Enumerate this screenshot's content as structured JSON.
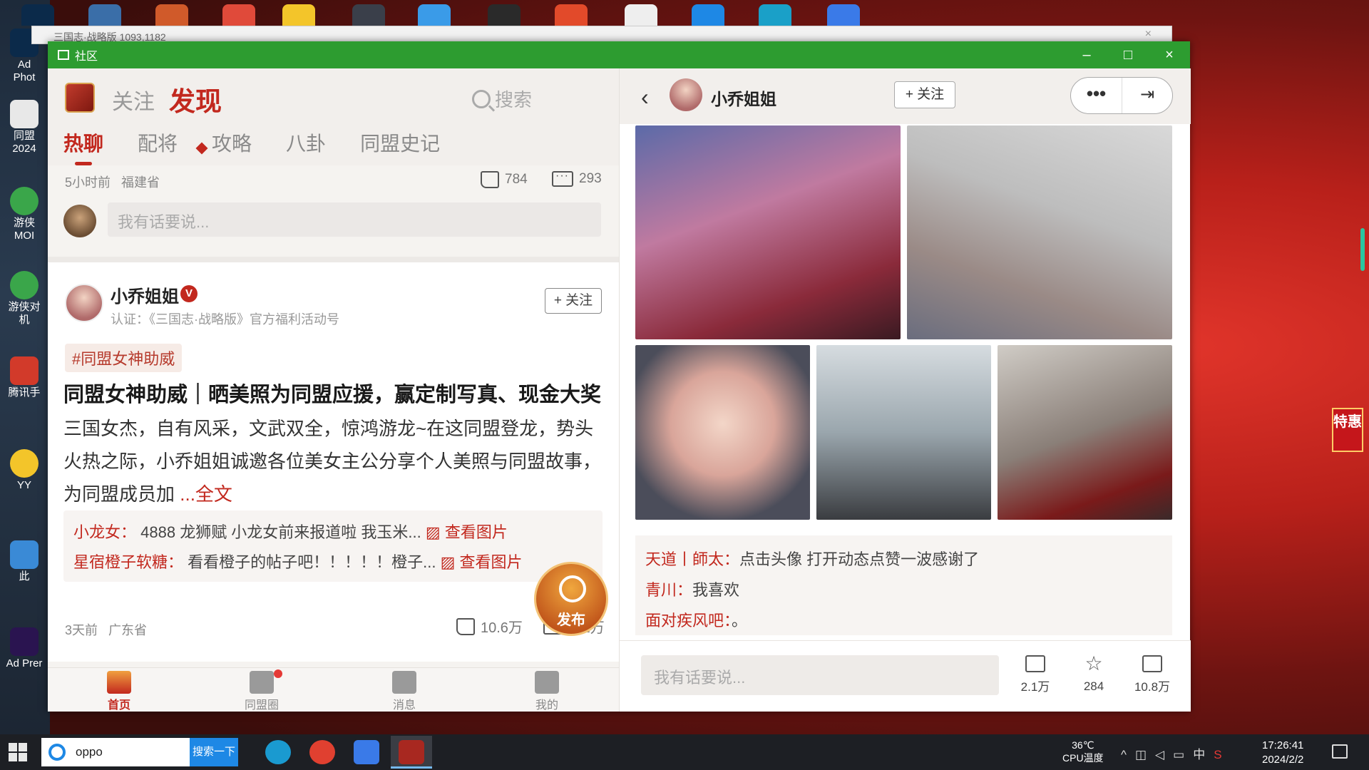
{
  "desktop": {
    "icons": [
      {
        "label": "Ad Phot"
      },
      {
        "label": "同盟 2024"
      },
      {
        "label": "游侠 MOI"
      },
      {
        "label": "游侠对 机"
      },
      {
        "label": "腾讯手"
      },
      {
        "label": "YY"
      },
      {
        "label": "此"
      },
      {
        "label": "Ad Prer"
      }
    ],
    "background_window_title": "三国志·战略版 1093,1182",
    "promo_badge": "特惠"
  },
  "window": {
    "title": "社区",
    "minimize": "–",
    "maximize": "□",
    "close": "×"
  },
  "left": {
    "nav": {
      "follow": "关注",
      "discover": "发现"
    },
    "search_placeholder": "搜索",
    "subtabs": [
      "热聊",
      "配将",
      "攻略",
      "八卦",
      "同盟史记"
    ],
    "post1": {
      "time": "5小时前",
      "location": "福建省",
      "likes": "784",
      "comments": "293",
      "comment_placeholder": "我有话要说..."
    },
    "post2": {
      "author": "小乔姐姐",
      "verified": "V",
      "certification": "认证：《三国志·战略版》官方福利活动号",
      "follow": "+ 关注",
      "tag": "#同盟女神助威",
      "title": "同盟女神助威｜晒美照为同盟应援，赢定制写真、现金大奖",
      "body": "三国女杰，自有风采，文武双全，惊鸿游龙~在这同盟登龙，势头火热之际，小乔姐姐诚邀各位美女主公分享个人美照与同盟故事，为同盟成员加",
      "more": "...全文",
      "comments": [
        {
          "user": "小龙女：",
          "text": "4888 龙狮赋 小龙女前来报道啦 我玉米...",
          "link": "查看图片"
        },
        {
          "user": "星宿橙子软糖：",
          "text": "看看橙子的帖子吧！！！！！橙子...",
          "link": "查看图片"
        }
      ],
      "time": "3天前",
      "location": "广东省",
      "likes": "10.6万",
      "comment_count": "2.1万"
    },
    "publish": "发布",
    "bottom_nav": [
      {
        "label": "首页"
      },
      {
        "label": "同盟圈"
      },
      {
        "label": "消息"
      },
      {
        "label": "我的"
      }
    ]
  },
  "right": {
    "author": "小乔姐姐",
    "follow": "+ 关注",
    "more": "•••",
    "comments": [
      {
        "user": "天道丨師太：",
        "text": "点击头像 打开动态点赞一波感谢了"
      },
      {
        "user": "青川：",
        "text": "我喜欢"
      },
      {
        "user": "面对疾风吧：",
        "text": "。"
      }
    ],
    "input_placeholder": "我有话要说...",
    "stats": {
      "comments": "2.1万",
      "favorites": "284",
      "likes": "10.8万"
    }
  },
  "taskbar": {
    "search_text": "oppo",
    "search_button": "搜索一下",
    "temp": "36℃",
    "temp_label": "CPU温度",
    "ime": "中",
    "time": "17:26:41",
    "date": "2024/2/2"
  }
}
